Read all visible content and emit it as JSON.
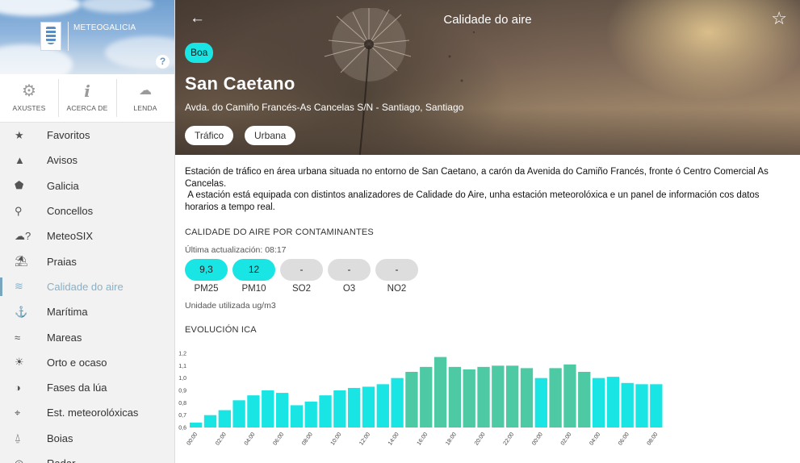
{
  "sidebar": {
    "logo_text": "METEOGALICIA",
    "help_label": "?",
    "quick_actions": [
      {
        "label": "AXUSTES",
        "icon": "gear-icon"
      },
      {
        "label": "ACERCA DE",
        "icon": "info-icon"
      },
      {
        "label": "LENDA",
        "icon": "weather-legend-icon"
      }
    ],
    "menu": [
      {
        "label": "Favoritos",
        "icon": "star-icon",
        "glyph": "★"
      },
      {
        "label": "Avisos",
        "icon": "warning-icon",
        "glyph": "▲"
      },
      {
        "label": "Galicia",
        "icon": "galicia-map-icon",
        "glyph": "⬟"
      },
      {
        "label": "Concellos",
        "icon": "location-pin-icon",
        "glyph": "⚲"
      },
      {
        "label": "MeteoSIX",
        "icon": "meteosix-icon",
        "glyph": "☁?"
      },
      {
        "label": "Praias",
        "icon": "beach-icon",
        "glyph": "⛱"
      },
      {
        "label": "Calidade do aire",
        "icon": "air-quality-icon",
        "glyph": "≋",
        "active": true
      },
      {
        "label": "Marítima",
        "icon": "anchor-icon",
        "glyph": "⚓"
      },
      {
        "label": "Mareas",
        "icon": "tide-icon",
        "glyph": "≈"
      },
      {
        "label": "Orto e ocaso",
        "icon": "sunrise-icon",
        "glyph": "☀"
      },
      {
        "label": "Fases da lúa",
        "icon": "moon-icon",
        "glyph": "◑"
      },
      {
        "label": "Est. meteorolóxicas",
        "icon": "weather-station-icon",
        "glyph": "⌖"
      },
      {
        "label": "Boias",
        "icon": "buoy-icon",
        "glyph": "⍙"
      },
      {
        "label": "Radar",
        "icon": "radar-icon",
        "glyph": "◎"
      }
    ]
  },
  "header": {
    "title": "Calidade do aire",
    "back_icon": "arrow-left-icon",
    "favorite_icon": "star-outline-icon"
  },
  "station": {
    "quality": "Boa",
    "quality_color": "#1ae5e5",
    "name": "San Caetano",
    "address": "Avda. do Camiño Francés-As Cancelas S/N - Santiago, Santiago",
    "tags": [
      "Tráfico",
      "Urbana"
    ],
    "description_1": "Estación de tráfico en área urbana situada no entorno de San Caetano, a carón da Avenida do Camiño Francés, fronte ó Centro Comercial As Cancelas.",
    "description_2": " A estación está equipada con distintos analizadores de Calidade do Aire, unha estación meteorolóxica e un panel de información cos datos horarios a tempo real."
  },
  "pollutants_section": {
    "title": "CALIDADE DO AIRE POR CONTAMINANTES",
    "last_update_label": "Última actualización:",
    "last_update_value": "08:17",
    "items": [
      {
        "name": "PM25",
        "value": "9,3",
        "active": true
      },
      {
        "name": "PM10",
        "value": "12",
        "active": true
      },
      {
        "name": "SO2",
        "value": "-",
        "active": false
      },
      {
        "name": "O3",
        "value": "-",
        "active": false
      },
      {
        "name": "NO2",
        "value": "-",
        "active": false
      }
    ],
    "unit_label": "Unidade utilizada",
    "unit_value": "ug/m3"
  },
  "evolution_section": {
    "title": "EVOLUCIÓN ICA"
  },
  "chart_data": {
    "type": "bar",
    "title": "",
    "xlabel": "",
    "ylabel": "",
    "ylim": [
      0.6,
      1.2
    ],
    "yticks": [
      "0,6",
      "0,7",
      "0,8",
      "0,9",
      "1,0",
      "1,1",
      "1,2"
    ],
    "xticks": [
      "00:00",
      "02:00",
      "04:00",
      "06:00",
      "08:00",
      "10:00",
      "12:00",
      "14:00",
      "16:00",
      "18:00",
      "20:00",
      "22:00",
      "00:00",
      "02:00",
      "04:00",
      "06:00",
      "08:00"
    ],
    "colors": [
      "#1ae5e5",
      "#4dc9a3"
    ],
    "values": [
      0.64,
      0.7,
      0.74,
      0.82,
      0.86,
      0.9,
      0.88,
      0.78,
      0.81,
      0.86,
      0.9,
      0.92,
      0.93,
      0.95,
      1.0,
      1.05,
      1.09,
      1.17,
      1.09,
      1.07,
      1.09,
      1.1,
      1.1,
      1.08,
      1.0,
      1.08,
      1.11,
      1.05,
      1.0,
      1.01,
      0.96,
      0.95,
      0.95
    ],
    "bar_color_index": [
      0,
      0,
      0,
      0,
      0,
      0,
      0,
      0,
      0,
      0,
      0,
      0,
      0,
      0,
      0,
      1,
      1,
      1,
      1,
      1,
      1,
      1,
      1,
      1,
      0,
      1,
      1,
      1,
      0,
      0,
      0,
      0,
      0
    ]
  }
}
